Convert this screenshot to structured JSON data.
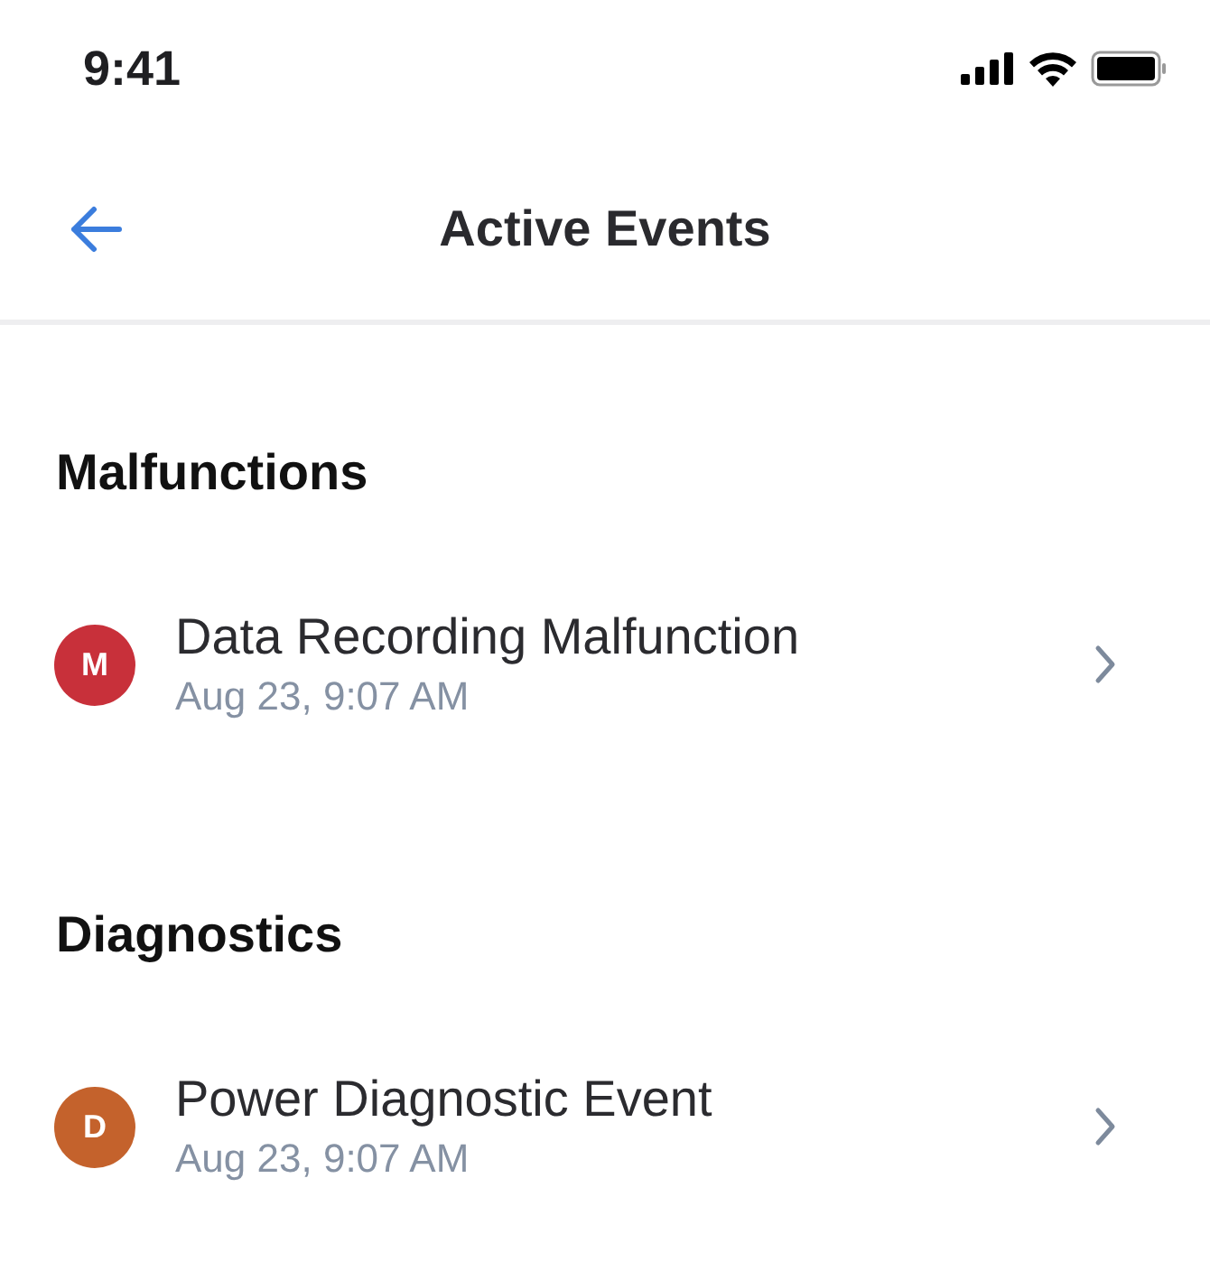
{
  "status_bar": {
    "time": "9:41"
  },
  "nav_bar": {
    "title": "Active Events"
  },
  "sections": [
    {
      "title": "Malfunctions",
      "events": [
        {
          "badge": "M",
          "color": "#c8303a",
          "name": "Data Recording Malfunction",
          "time": "Aug 23, 9:07 AM"
        }
      ]
    },
    {
      "title": "Diagnostics",
      "events": [
        {
          "badge": "D",
          "color": "#c4622c",
          "name": "Power Diagnostic Event",
          "time": "Aug 23, 9:07 AM"
        }
      ]
    }
  ]
}
